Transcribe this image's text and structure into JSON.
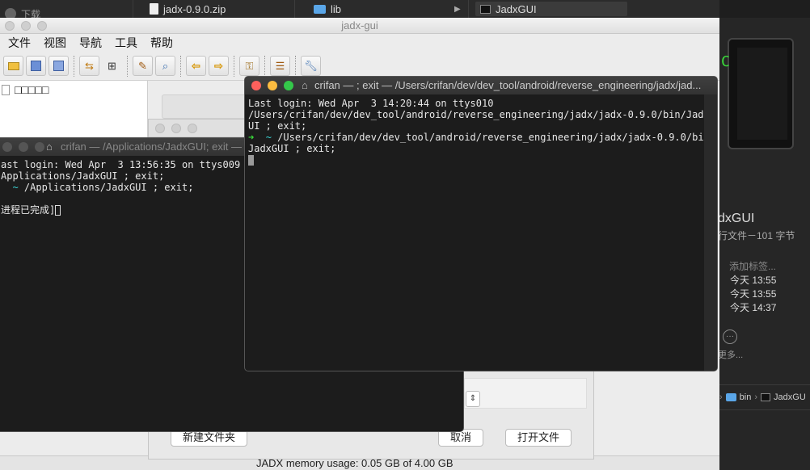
{
  "bg": {
    "download_label": "下载",
    "zip_file": "jadx-0.9.0.zip",
    "lib_folder": "lib",
    "selected_file": "JadxGUI"
  },
  "finder_right": {
    "preview_char": "C",
    "title": "dxGUI",
    "subtitle": "行文件－101 字节",
    "tag_label": "添加标签...",
    "dates": [
      "今天 13:55",
      "今天 13:55",
      "今天 14:37"
    ],
    "more_label": "更多...",
    "path_bin": "bin",
    "path_jadx": "JadxGU"
  },
  "jadx": {
    "title": "jadx-gui",
    "menu": [
      "文件",
      "视图",
      "导航",
      "工具",
      "帮助"
    ],
    "tree_root": "□□□□□",
    "status": "JADX memory usage: 0.05 GB of 4.00 GB"
  },
  "dialog": {
    "new_folder": "新建文件夹",
    "cancel": "取消",
    "open_file": "打开文件"
  },
  "term_back": {
    "title": "crifan — /Applications/JadxGUI; exit —",
    "line1": "ast login: Wed Apr  3 13:56:35 on ttys009",
    "line2": "Applications/JadxGUI ; exit;",
    "line3_path": "/Applications/JadxGUI ; exit;",
    "line4": "进程已完成]"
  },
  "term_front": {
    "title": "crifan — ; exit — /Users/crifan/dev/dev_tool/android/reverse_engineering/jadx/jad...",
    "line1": "Last login: Wed Apr  3 14:20:44 on ttys010",
    "line2": "/Users/crifan/dev/dev_tool/android/reverse_engineering/jadx/jadx-0.9.0/bin/JadxG",
    "line3": "UI ; exit;",
    "prompt_arrow": "➜",
    "prompt_tilde": "~",
    "line4_cmd": " /Users/crifan/dev/dev_tool/android/reverse_engineering/jadx/jadx-0.9.0/bin/",
    "line5": "JadxGUI ; exit;"
  }
}
